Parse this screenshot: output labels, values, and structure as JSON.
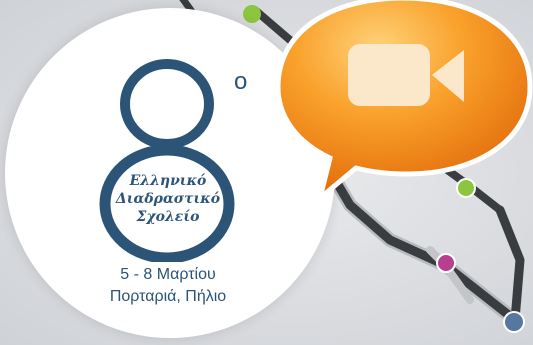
{
  "badge": {
    "edition_number": "8",
    "ordinal_mark": "ο",
    "title_lines": [
      "Ελληνικό",
      "Διαδραστικό",
      "Σχολείο"
    ],
    "dates": "5 - 8 Μαρτίου",
    "location": "Πορταριά, Πήλιο"
  },
  "video_button": {
    "icon": "video-camera-icon",
    "bubble_color": "#f7941d",
    "icon_color": "#fbe7c9"
  },
  "colors": {
    "text_primary": "#2b5477",
    "node_green": "#8cc63f",
    "node_pink": "#b83f8e",
    "node_blue": "#5577a0",
    "network_line": "#3a3d40"
  }
}
